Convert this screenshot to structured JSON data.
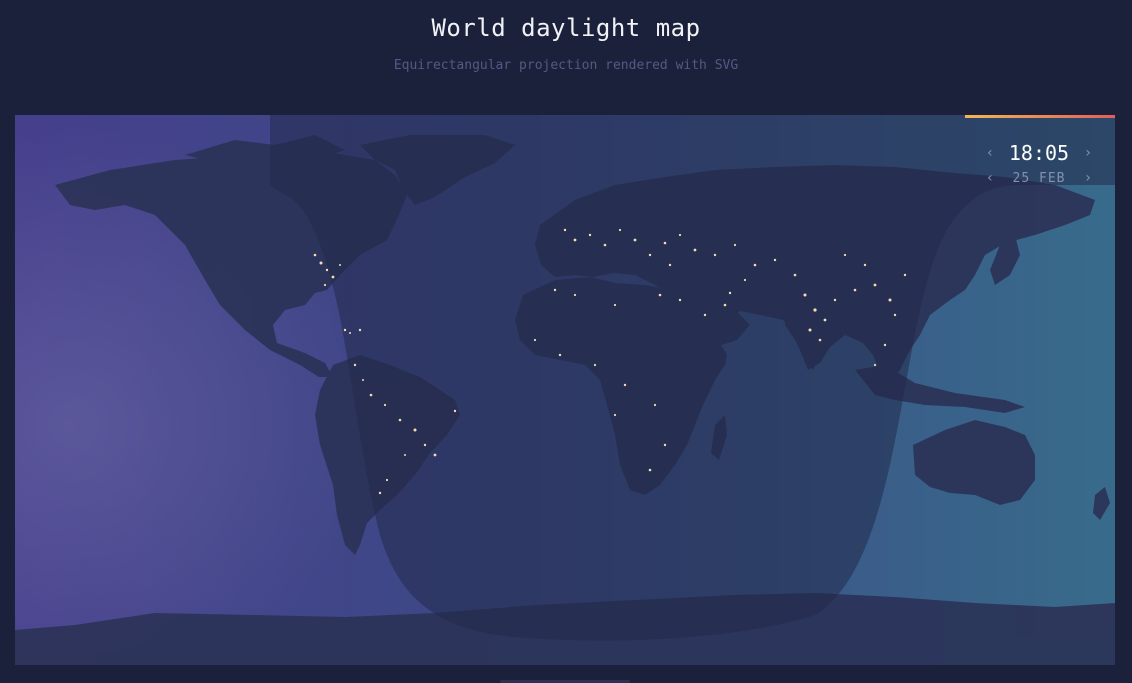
{
  "header": {
    "title": "World daylight map",
    "subtitle": "Equirectangular projection rendered with SVG"
  },
  "clock": {
    "time": "18:05",
    "date": "25 FEB",
    "prev_time_icon": "chevron-left-icon",
    "next_time_icon": "chevron-right-icon",
    "prev_date_icon": "chevron-left-icon",
    "next_date_icon": "chevron-right-icon"
  },
  "colors": {
    "page_background": "#1c213b",
    "day_left": "#463f8c",
    "day_right": "#3a6a8a",
    "night_overlay": "#252c4c",
    "land": "#2a3357",
    "city_lights": "#f6dcae",
    "progress_start": "#f1b657",
    "progress_end": "#e0605a"
  },
  "map": {
    "projection": "Equirectangular"
  }
}
